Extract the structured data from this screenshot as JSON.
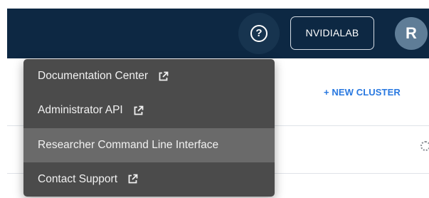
{
  "topbar": {
    "help_icon": "help-circle-icon",
    "help_glyph": "?",
    "tenant_label": "NVIDIALAB",
    "avatar_initial": "R"
  },
  "content": {
    "new_cluster_label": "+ NEW CLUSTER",
    "settings_icon": "gear-icon"
  },
  "menu": {
    "items": [
      {
        "label": "Documentation Center",
        "external": true,
        "icon": "external-link-icon"
      },
      {
        "label": "Administrator API",
        "external": true,
        "icon": "external-link-icon"
      },
      {
        "label": "Researcher Command Line Interface",
        "external": false,
        "highlighted": true
      },
      {
        "label": "Contact Support",
        "external": true,
        "icon": "external-link-icon"
      }
    ]
  },
  "colors": {
    "topbar_bg": "#0d2843",
    "menu_bg": "#4b4b4b",
    "menu_highlight": "#6a6a6a",
    "accent_link": "#2878e0",
    "avatar_bg": "#5f7d97"
  }
}
